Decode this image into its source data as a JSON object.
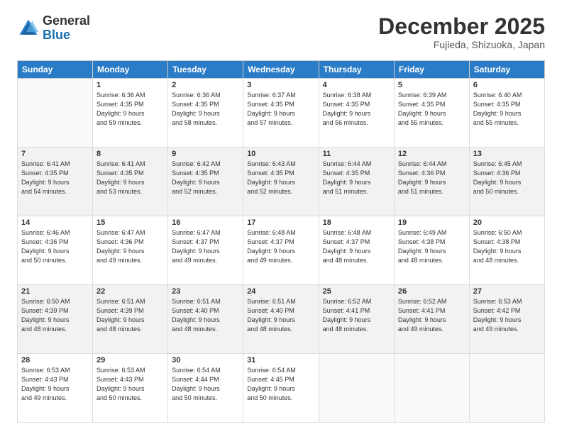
{
  "logo": {
    "general": "General",
    "blue": "Blue"
  },
  "header": {
    "month": "December 2025",
    "location": "Fujieda, Shizuoka, Japan"
  },
  "weekdays": [
    "Sunday",
    "Monday",
    "Tuesday",
    "Wednesday",
    "Thursday",
    "Friday",
    "Saturday"
  ],
  "weeks": [
    [
      {
        "day": "",
        "info": ""
      },
      {
        "day": "1",
        "info": "Sunrise: 6:36 AM\nSunset: 4:35 PM\nDaylight: 9 hours\nand 59 minutes."
      },
      {
        "day": "2",
        "info": "Sunrise: 6:36 AM\nSunset: 4:35 PM\nDaylight: 9 hours\nand 58 minutes."
      },
      {
        "day": "3",
        "info": "Sunrise: 6:37 AM\nSunset: 4:35 PM\nDaylight: 9 hours\nand 57 minutes."
      },
      {
        "day": "4",
        "info": "Sunrise: 6:38 AM\nSunset: 4:35 PM\nDaylight: 9 hours\nand 56 minutes."
      },
      {
        "day": "5",
        "info": "Sunrise: 6:39 AM\nSunset: 4:35 PM\nDaylight: 9 hours\nand 55 minutes."
      },
      {
        "day": "6",
        "info": "Sunrise: 6:40 AM\nSunset: 4:35 PM\nDaylight: 9 hours\nand 55 minutes."
      }
    ],
    [
      {
        "day": "7",
        "info": "Sunrise: 6:41 AM\nSunset: 4:35 PM\nDaylight: 9 hours\nand 54 minutes."
      },
      {
        "day": "8",
        "info": "Sunrise: 6:41 AM\nSunset: 4:35 PM\nDaylight: 9 hours\nand 53 minutes."
      },
      {
        "day": "9",
        "info": "Sunrise: 6:42 AM\nSunset: 4:35 PM\nDaylight: 9 hours\nand 52 minutes."
      },
      {
        "day": "10",
        "info": "Sunrise: 6:43 AM\nSunset: 4:35 PM\nDaylight: 9 hours\nand 52 minutes."
      },
      {
        "day": "11",
        "info": "Sunrise: 6:44 AM\nSunset: 4:35 PM\nDaylight: 9 hours\nand 51 minutes."
      },
      {
        "day": "12",
        "info": "Sunrise: 6:44 AM\nSunset: 4:36 PM\nDaylight: 9 hours\nand 51 minutes."
      },
      {
        "day": "13",
        "info": "Sunrise: 6:45 AM\nSunset: 4:36 PM\nDaylight: 9 hours\nand 50 minutes."
      }
    ],
    [
      {
        "day": "14",
        "info": "Sunrise: 6:46 AM\nSunset: 4:36 PM\nDaylight: 9 hours\nand 50 minutes."
      },
      {
        "day": "15",
        "info": "Sunrise: 6:47 AM\nSunset: 4:36 PM\nDaylight: 9 hours\nand 49 minutes."
      },
      {
        "day": "16",
        "info": "Sunrise: 6:47 AM\nSunset: 4:37 PM\nDaylight: 9 hours\nand 49 minutes."
      },
      {
        "day": "17",
        "info": "Sunrise: 6:48 AM\nSunset: 4:37 PM\nDaylight: 9 hours\nand 49 minutes."
      },
      {
        "day": "18",
        "info": "Sunrise: 6:48 AM\nSunset: 4:37 PM\nDaylight: 9 hours\nand 48 minutes."
      },
      {
        "day": "19",
        "info": "Sunrise: 6:49 AM\nSunset: 4:38 PM\nDaylight: 9 hours\nand 48 minutes."
      },
      {
        "day": "20",
        "info": "Sunrise: 6:50 AM\nSunset: 4:38 PM\nDaylight: 9 hours\nand 48 minutes."
      }
    ],
    [
      {
        "day": "21",
        "info": "Sunrise: 6:50 AM\nSunset: 4:39 PM\nDaylight: 9 hours\nand 48 minutes."
      },
      {
        "day": "22",
        "info": "Sunrise: 6:51 AM\nSunset: 4:39 PM\nDaylight: 9 hours\nand 48 minutes."
      },
      {
        "day": "23",
        "info": "Sunrise: 6:51 AM\nSunset: 4:40 PM\nDaylight: 9 hours\nand 48 minutes."
      },
      {
        "day": "24",
        "info": "Sunrise: 6:51 AM\nSunset: 4:40 PM\nDaylight: 9 hours\nand 48 minutes."
      },
      {
        "day": "25",
        "info": "Sunrise: 6:52 AM\nSunset: 4:41 PM\nDaylight: 9 hours\nand 48 minutes."
      },
      {
        "day": "26",
        "info": "Sunrise: 6:52 AM\nSunset: 4:41 PM\nDaylight: 9 hours\nand 49 minutes."
      },
      {
        "day": "27",
        "info": "Sunrise: 6:53 AM\nSunset: 4:42 PM\nDaylight: 9 hours\nand 49 minutes."
      }
    ],
    [
      {
        "day": "28",
        "info": "Sunrise: 6:53 AM\nSunset: 4:43 PM\nDaylight: 9 hours\nand 49 minutes."
      },
      {
        "day": "29",
        "info": "Sunrise: 6:53 AM\nSunset: 4:43 PM\nDaylight: 9 hours\nand 50 minutes."
      },
      {
        "day": "30",
        "info": "Sunrise: 6:54 AM\nSunset: 4:44 PM\nDaylight: 9 hours\nand 50 minutes."
      },
      {
        "day": "31",
        "info": "Sunrise: 6:54 AM\nSunset: 4:45 PM\nDaylight: 9 hours\nand 50 minutes."
      },
      {
        "day": "",
        "info": ""
      },
      {
        "day": "",
        "info": ""
      },
      {
        "day": "",
        "info": ""
      }
    ]
  ]
}
